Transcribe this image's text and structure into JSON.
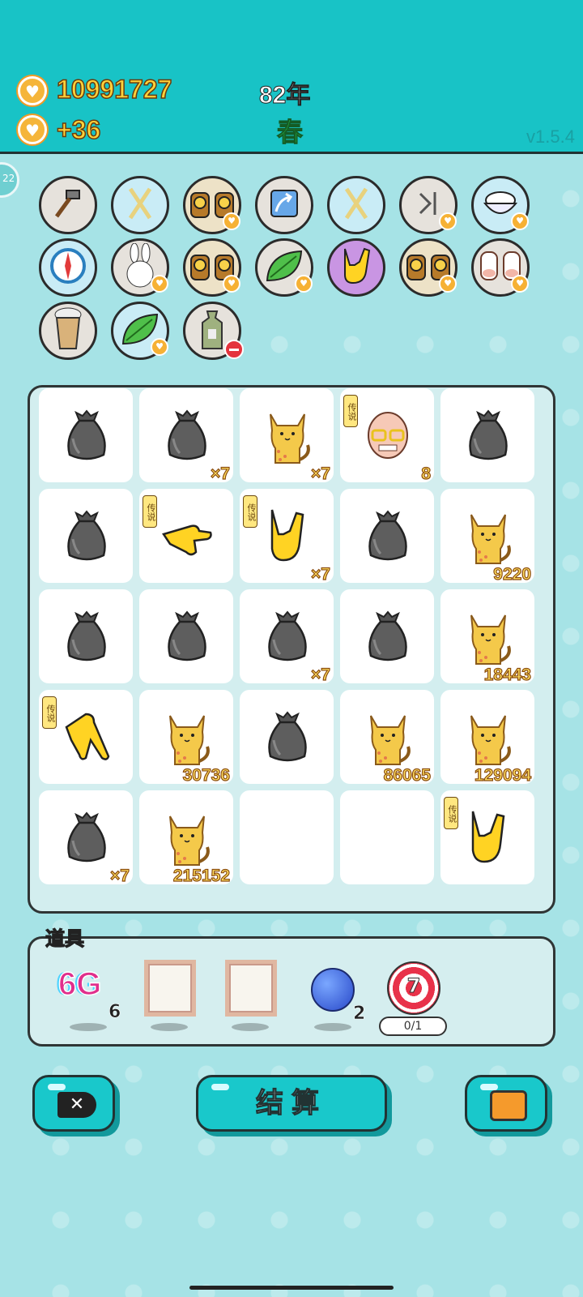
{
  "header": {
    "coins": "10991727",
    "income": "+36",
    "year": "82年",
    "season": "春",
    "version": "v1.5.4",
    "side_tab": "22"
  },
  "collection": [
    [
      {
        "icon": "hammer-icon",
        "bg": "gray"
      },
      {
        "icon": "chopsticks-icon",
        "bg": "blue"
      },
      {
        "icon": "owl-icon",
        "bg": "tan",
        "heart": true
      },
      {
        "icon": "arrow-card-icon",
        "bg": "gray"
      },
      {
        "icon": "chopsticks-icon",
        "bg": "blue"
      },
      {
        "icon": "skip-icon",
        "bg": "gray",
        "heart": true
      },
      {
        "icon": "rice-bowl-icon",
        "bg": "blue",
        "heart": true
      }
    ],
    [
      {
        "icon": "compass-icon",
        "bg": "blue"
      },
      {
        "icon": "rabbit-icon",
        "bg": "gray",
        "heart": true
      },
      {
        "icon": "owl-icon",
        "bg": "tan",
        "heart": true
      },
      {
        "icon": "leaf-icon",
        "bg": "gray",
        "heart": true
      },
      {
        "icon": "rock-hand-icon",
        "bg": "purple"
      },
      {
        "icon": "owl-icon",
        "bg": "tan",
        "heart": true
      },
      {
        "icon": "cow-icon",
        "bg": "gray",
        "heart": true
      }
    ],
    [
      {
        "icon": "bubble-tea-icon",
        "bg": "gray"
      },
      {
        "icon": "leaf-icon",
        "bg": "blue",
        "heart": true
      },
      {
        "icon": "bag-icon",
        "bg": "gray",
        "minus": true
      }
    ]
  ],
  "board": [
    [
      {
        "sym": "trash-bag",
        "count": ""
      },
      {
        "sym": "trash-bag",
        "count": "×7"
      },
      {
        "sym": "cat",
        "count": "×7"
      },
      {
        "sym": "old-man",
        "count": "8",
        "tag": "传说"
      },
      {
        "sym": "trash-bag",
        "count": ""
      }
    ],
    [
      {
        "sym": "trash-bag",
        "count": ""
      },
      {
        "sym": "point-hand",
        "count": "",
        "tag": "传说"
      },
      {
        "sym": "rock-hand",
        "count": "×7",
        "tag": "传说"
      },
      {
        "sym": "trash-bag",
        "count": ""
      },
      {
        "sym": "cat",
        "count": "9220"
      }
    ],
    [
      {
        "sym": "trash-bag",
        "count": ""
      },
      {
        "sym": "trash-bag",
        "count": ""
      },
      {
        "sym": "trash-bag",
        "count": "×7"
      },
      {
        "sym": "trash-bag",
        "count": ""
      },
      {
        "sym": "cat",
        "count": "18443"
      }
    ],
    [
      {
        "sym": "point-down-hand",
        "count": "",
        "tag": "传说"
      },
      {
        "sym": "cat",
        "count": "30736"
      },
      {
        "sym": "trash-bag",
        "count": ""
      },
      {
        "sym": "cat",
        "count": "86065"
      },
      {
        "sym": "cat",
        "count": "129094"
      }
    ],
    [
      {
        "sym": "trash-bag",
        "count": "×7"
      },
      {
        "sym": "cat",
        "count": "215152"
      },
      {
        "sym": "empty",
        "count": ""
      },
      {
        "sym": "empty",
        "count": ""
      },
      {
        "sym": "rock-hand",
        "count": "",
        "tag": "传说"
      }
    ]
  ],
  "items": {
    "title": "道具",
    "g6_text": "6G",
    "g6_count": "6",
    "blueberry_count": "2",
    "target_number": "7",
    "target_progress": "0/1"
  },
  "buttons": {
    "settle": "结算"
  },
  "colors": {
    "header": "#18c3c6",
    "background": "#a6e3e6",
    "button": "#19c8cb",
    "gold": "#ffd23a"
  }
}
